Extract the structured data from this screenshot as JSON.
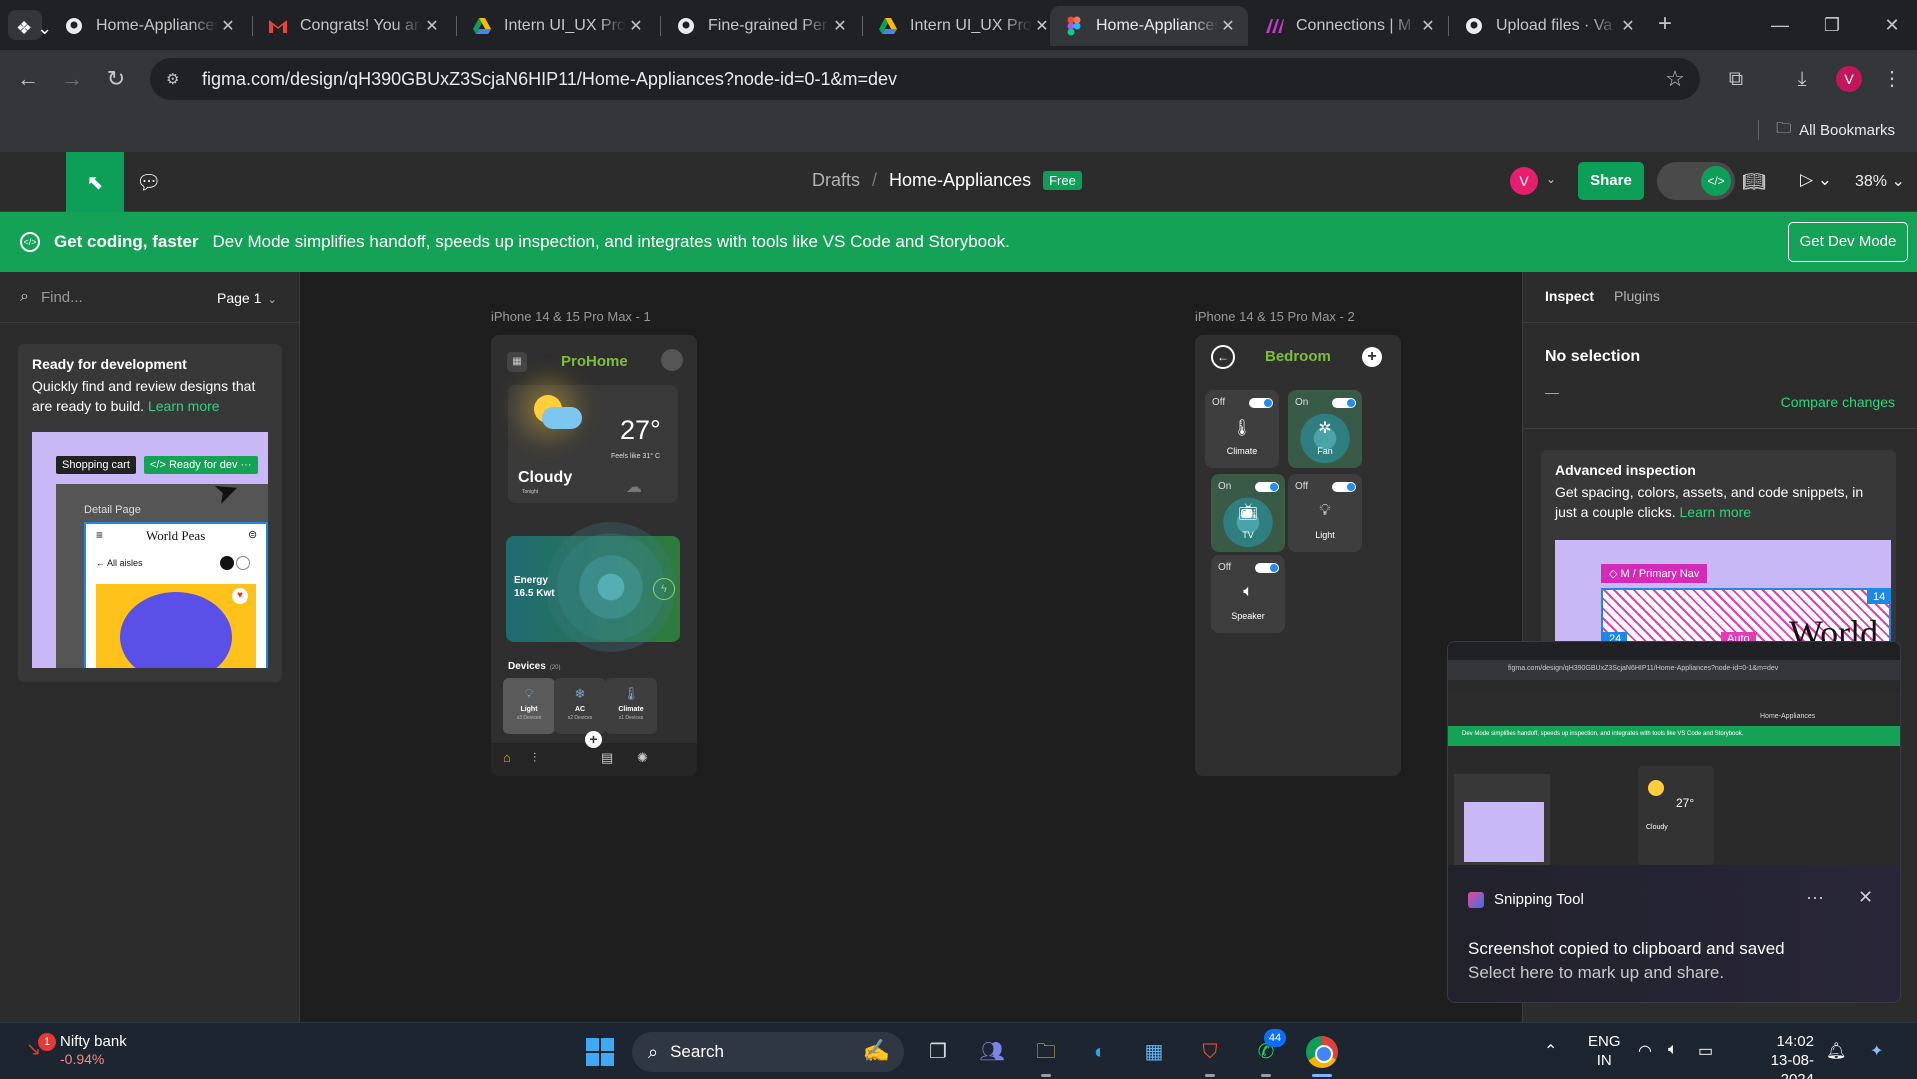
{
  "browser": {
    "tabs": [
      {
        "label": "Home-Appliances",
        "icon": "github-icon"
      },
      {
        "label": "Congrats! You are",
        "icon": "gmail-icon"
      },
      {
        "label": "Intern UI_UX Pro",
        "icon": "google-drive-icon"
      },
      {
        "label": "Fine-grained Per",
        "icon": "github-icon"
      },
      {
        "label": "Intern UI_UX Pro",
        "icon": "google-drive-icon"
      },
      {
        "label": "Home-Appliances",
        "icon": "figma-icon",
        "active": true
      },
      {
        "label": "Connections | M",
        "icon": "miro-icon"
      },
      {
        "label": "Upload files · Va",
        "icon": "github-icon"
      }
    ],
    "url": "figma.com/design/qH390GBUxZ3ScjaN6HIP11/Home-Appliances?node-id=0-1&m=dev",
    "profile_initial": "V",
    "bookmarks_label": "All Bookmarks"
  },
  "figma": {
    "breadcrumb_drafts": "Drafts",
    "breadcrumb_sep": "/",
    "file_name": "Home-Appliances",
    "plan_badge": "Free",
    "user_initial": "V",
    "share_label": "Share",
    "zoom": "38%",
    "banner": {
      "title": "Get coding, faster",
      "text": "Dev Mode simplifies handoff, speeds up inspection, and integrates with tools like VS Code and Storybook.",
      "button": "Get Dev Mode"
    },
    "left_panel": {
      "search_placeholder": "Find...",
      "page": "Page 1",
      "card_title": "Ready for development",
      "card_text": "Quickly find and review designs that are ready to build.",
      "card_link": "Learn more",
      "illus_tag1": "Shopping cart",
      "illus_tag2": "Ready for dev",
      "illus_frame_label": "Detail Page",
      "illus_brand": "World Peas",
      "illus_back": "All aisles"
    },
    "right_panel": {
      "tab_inspect": "Inspect",
      "tab_plugins": "Plugins",
      "no_selection": "No selection",
      "dash": "—",
      "compare": "Compare changes",
      "adv_title": "Advanced inspection",
      "adv_text": "Get spacing, colors, assets, and code snippets, in just a couple clicks.",
      "adv_link": "Learn more",
      "illus_nav": "M / Primary Nav",
      "illus_14": "14",
      "illus_24": "24",
      "illus_auto": "Auto",
      "illus_world": "World"
    },
    "frames": {
      "frame1_label": "iPhone 14 & 15 Pro Max - 1",
      "frame2_label": "iPhone 14 & 15 Pro Max - 2"
    }
  },
  "app_home": {
    "title": "ProHome",
    "temperature": "27°",
    "feels_like": "Feels like 31° C",
    "condition": "Cloudy",
    "tonight": "Tonight",
    "energy_label": "Energy",
    "energy_value": "16.5 Kwt",
    "devices_label": "Devices",
    "devices_count": "(20)",
    "devices": [
      {
        "name": "Light",
        "count": "x3 Devices"
      },
      {
        "name": "AC",
        "count": "x2 Devices"
      },
      {
        "name": "Climate",
        "count": "x1 Devices"
      }
    ]
  },
  "app_room": {
    "title": "Bedroom",
    "appliances": [
      {
        "state": "Off",
        "name": "Climate",
        "icon": "thermometer-icon"
      },
      {
        "state": "On",
        "name": "Fan",
        "icon": "fan-icon"
      },
      {
        "state": "On",
        "name": "TV",
        "icon": "tv-icon"
      },
      {
        "state": "Off",
        "name": "Light",
        "icon": "lightbulb-icon"
      },
      {
        "state": "Off",
        "name": "Speaker",
        "icon": "speaker-icon"
      }
    ]
  },
  "toast": {
    "app": "Snipping Tool",
    "message": "Screenshot copied to clipboard and saved",
    "sub": "Select here to mark up and share."
  },
  "taskbar": {
    "stock_name": "Nifty bank",
    "stock_change": "-0.94%",
    "stock_badge": "1",
    "search_label": "Search",
    "whatsapp_badge": "44",
    "lang_line1": "ENG",
    "lang_line2": "IN",
    "time": "14:02",
    "date": "13-08-2024"
  },
  "colors": {
    "figma_green": "#14a257",
    "accent_green": "#2ed47a",
    "app_green": "#7cbf3a",
    "toggle_blue": "#1f8ef1"
  }
}
